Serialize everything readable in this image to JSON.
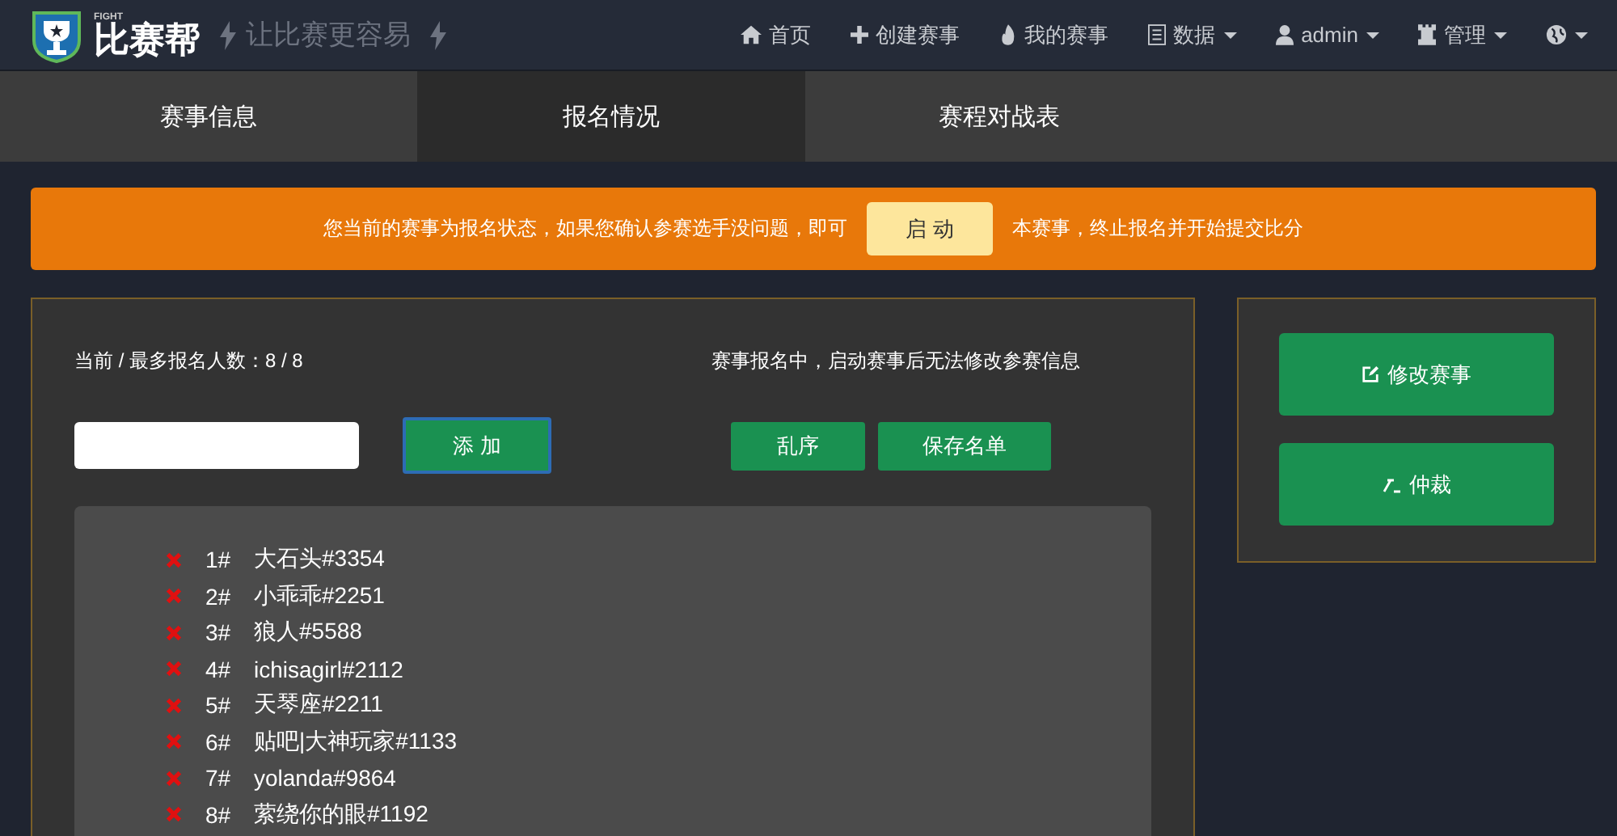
{
  "brand": {
    "small": "FIGHT",
    "name": "比赛帮",
    "tagline": "让比赛更容易"
  },
  "nav": [
    {
      "kind": "home",
      "label": "首页",
      "dropdown": false
    },
    {
      "kind": "plus",
      "label": "创建赛事",
      "dropdown": false
    },
    {
      "kind": "flame",
      "label": "我的赛事",
      "dropdown": false
    },
    {
      "kind": "list",
      "label": "数据",
      "dropdown": true
    },
    {
      "kind": "user",
      "label": "admin",
      "dropdown": true
    },
    {
      "kind": "rook",
      "label": "管理",
      "dropdown": true
    },
    {
      "kind": "globe",
      "dropdown": true
    }
  ],
  "tabs": [
    {
      "label": "赛事信息",
      "selected": false
    },
    {
      "label": "报名情况",
      "selected": true
    },
    {
      "label": "赛程对战表",
      "selected": false
    }
  ],
  "alert": {
    "before": "您当前的赛事为报名状态，如果您确认参赛选手没问题，即可",
    "button": "启 动",
    "after": "本赛事，终止报名并开始提交比分"
  },
  "count": "当前 / 最多报名人数：8 / 8",
  "notice": "赛事报名中，启动赛事后无法修改参赛信息",
  "add_button": "添 加",
  "shuffle_button": "乱序",
  "save_button": "保存名单",
  "players": [
    {
      "number": "1#",
      "name": "大石头#3354"
    },
    {
      "number": "2#",
      "name": "小乖乖#2251"
    },
    {
      "number": "3#",
      "name": "狼人#5588"
    },
    {
      "number": "4#",
      "name": "ichisagirl#2112"
    },
    {
      "number": "5#",
      "name": "天琴座#2211"
    },
    {
      "number": "6#",
      "name": "贴吧|大神玩家#1133"
    },
    {
      "number": "7#",
      "name": "yolanda#9864"
    },
    {
      "number": "8#",
      "name": "萦绕你的眼#1192"
    }
  ],
  "side_buttons": [
    {
      "kind": "edit",
      "label": "修改赛事"
    },
    {
      "kind": "gavel",
      "label": "仲裁"
    }
  ]
}
